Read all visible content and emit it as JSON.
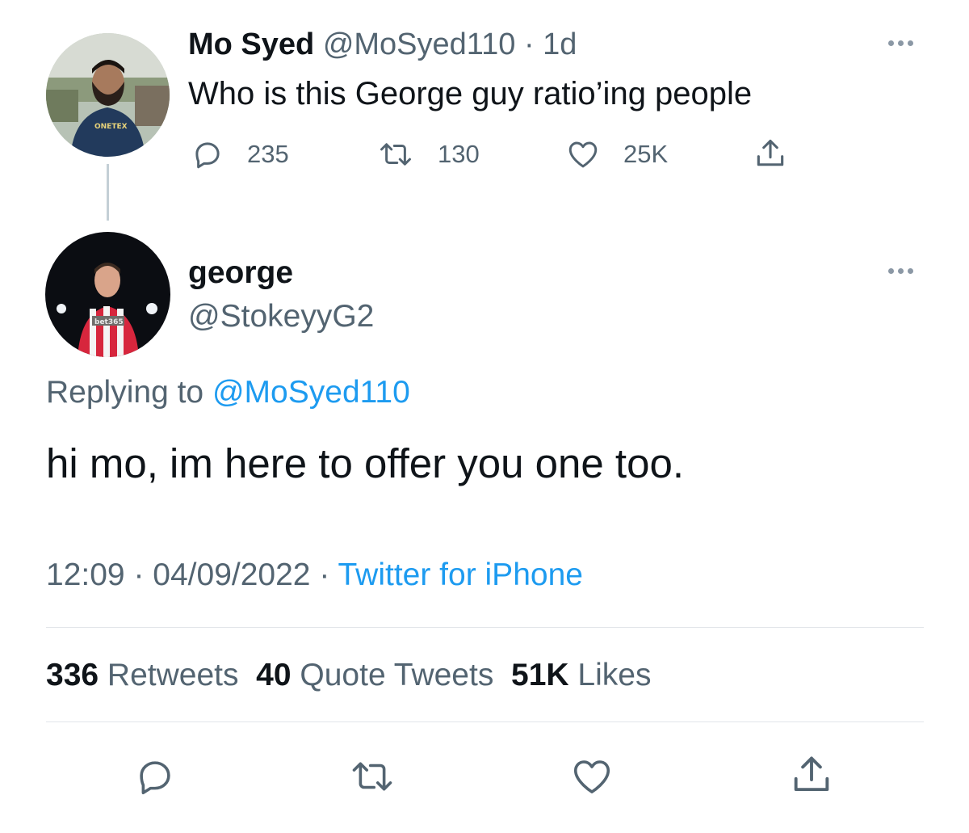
{
  "parent_tweet": {
    "author_name": "Mo Syed",
    "handle": "@MoSyed110",
    "separator": "·",
    "time_ago": "1d",
    "text": "Who is this George guy ratio’ing people",
    "avatar_icon": "person-avatar-hoodie",
    "hoodie_text": "ONETEX",
    "actions": [
      {
        "name": "reply",
        "icon": "reply-icon",
        "count": "235"
      },
      {
        "name": "retweet",
        "icon": "retweet-icon",
        "count": "130"
      },
      {
        "name": "like",
        "icon": "heart-icon",
        "count": "25K"
      },
      {
        "name": "share",
        "icon": "share-icon",
        "count": ""
      }
    ]
  },
  "main_tweet": {
    "author_name": "george",
    "handle": "@StokeyyG2",
    "avatar_icon": "person-avatar-football-kit",
    "shirt_text": "bet365",
    "replying_label": "Replying to",
    "replying_handle": "@MoSyed110",
    "text": "hi mo, im here to offer you one too.",
    "time": "12:09",
    "date": "04/09/2022",
    "separator": "·",
    "source": "Twitter for iPhone"
  },
  "stats": {
    "retweets_count": "336",
    "retweets_label": "Retweets",
    "quotes_count": "40",
    "quotes_label": "Quote Tweets",
    "likes_count": "51K",
    "likes_label": "Likes"
  },
  "action_bar": [
    "reply-icon",
    "retweet-icon",
    "heart-icon",
    "share-icon"
  ],
  "colors": {
    "text": "#0f1419",
    "muted": "#536471",
    "link": "#1d9bf0",
    "divider": "#e1e5e9"
  }
}
